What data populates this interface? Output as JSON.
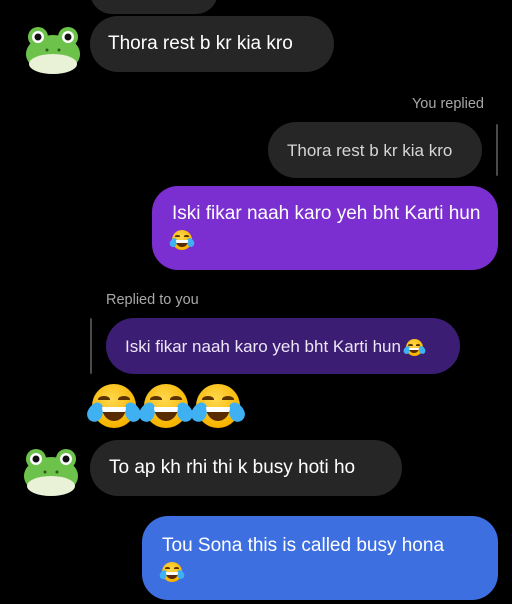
{
  "conversation": {
    "messages": [
      {
        "text": "Thora rest b kr kia kro"
      },
      {
        "reply_label": "You replied",
        "quoted_text": "Thora rest b kr kia kro"
      },
      {
        "text": "Iski fikar naah karo yeh bht Karti hun",
        "emoji": "laughing-tears-emoji"
      },
      {
        "reply_label": "Replied to you",
        "quoted_text": "Iski fikar naah karo yeh bht Karti hun",
        "emoji": "laughing-tears-emoji"
      },
      {
        "emojis": [
          "laughing-tears-emoji",
          "laughing-tears-emoji",
          "laughing-tears-emoji"
        ]
      },
      {
        "text": "To ap kh rhi thi k busy hoti ho"
      },
      {
        "text": "Tou Sona this is called busy hona",
        "emoji": "laughing-tears-emoji"
      }
    ]
  },
  "colors": {
    "background": "#000000",
    "incoming_bubble": "#262626",
    "outgoing_purple": "#7b2fd0",
    "quoted_purple": "#3c1d74",
    "outgoing_blue": "#3e6fe0",
    "meta_text": "#a8a8a8"
  }
}
